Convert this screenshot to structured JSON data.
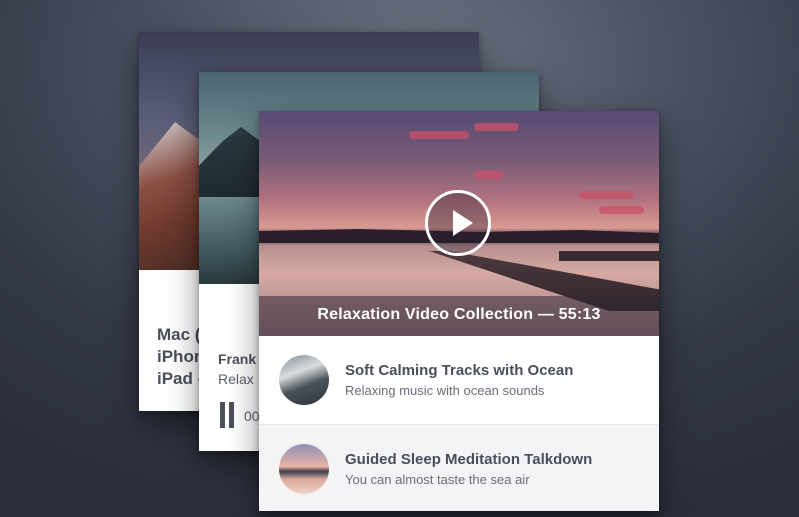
{
  "back_card": {
    "line1": "Mac (",
    "line2": "iPhon",
    "line3": "iPad -"
  },
  "middle_card": {
    "title": "Frank",
    "subtitle": "Relax",
    "time": "00"
  },
  "front_card": {
    "caption": "Relaxation Video Collection — 55:13",
    "tracks": [
      {
        "title": "Soft Calming Tracks with Ocean",
        "subtitle": "Relaxing music with ocean sounds",
        "icon": "ocean-rocks-thumbnail"
      },
      {
        "title": "Guided Sleep Meditation Talkdown",
        "subtitle": "You can almost taste the sea air",
        "icon": "sea-sunset-thumbnail"
      }
    ]
  }
}
